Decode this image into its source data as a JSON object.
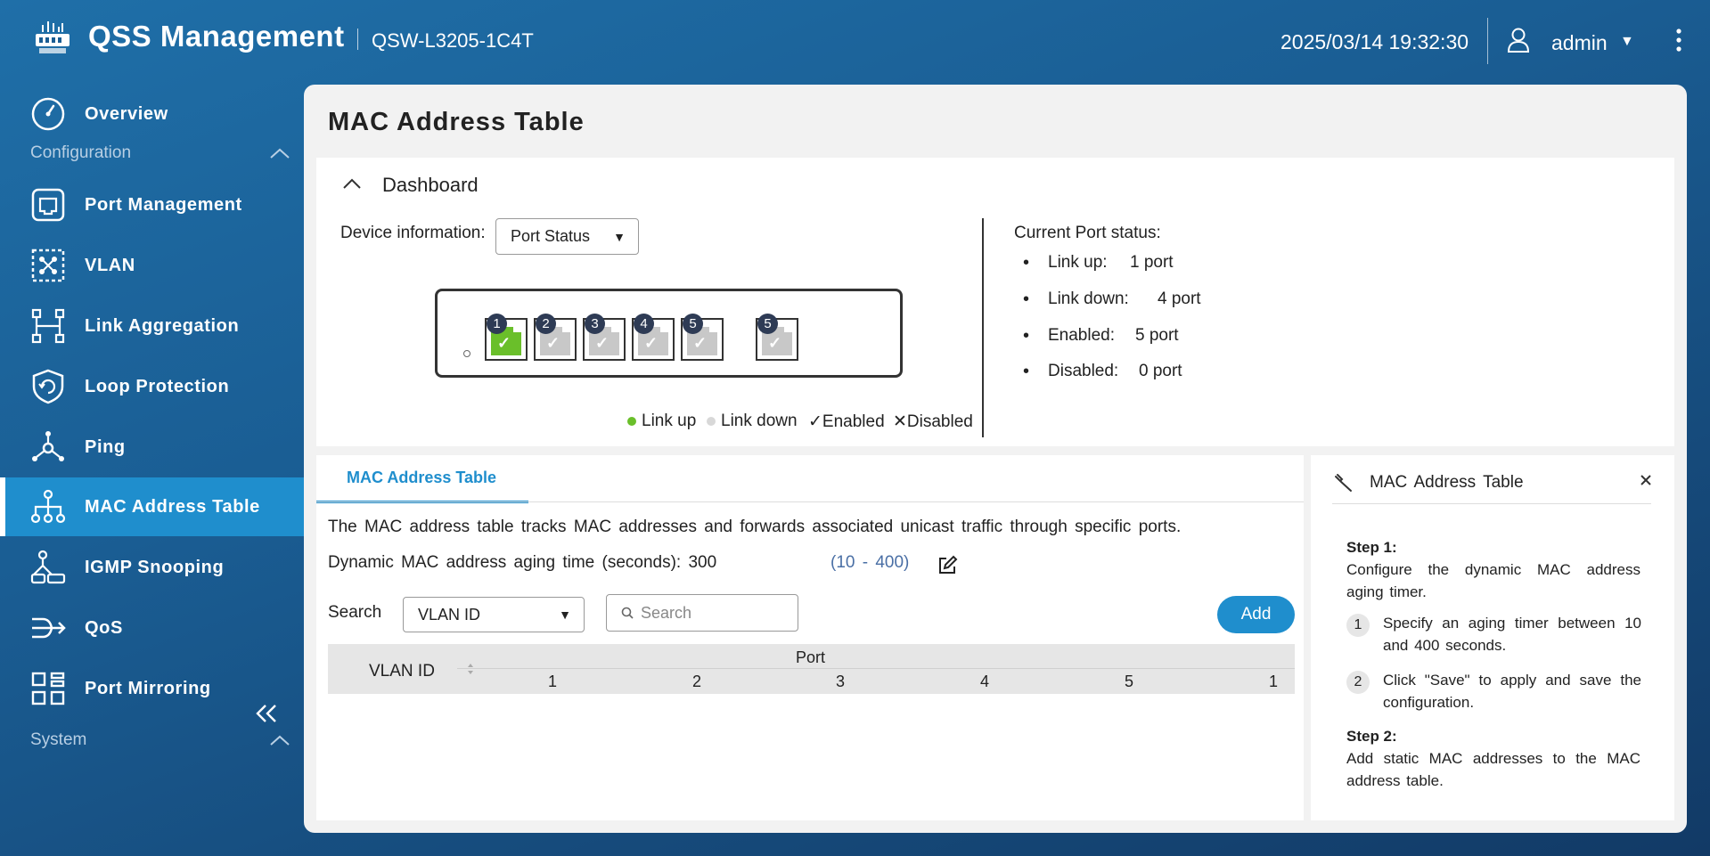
{
  "header": {
    "app_title": "QSS  Management",
    "model": "QSW-L3205-1C4T",
    "datetime": "2025/03/14  19:32:30",
    "username": "admin"
  },
  "sidebar": {
    "overview": "Overview",
    "config_section": "Configuration",
    "items": [
      {
        "label": "Port Management",
        "icon": "port-icon"
      },
      {
        "label": "VLAN",
        "icon": "vlan-icon"
      },
      {
        "label": "Link Aggregation",
        "icon": "link-aggregation-icon"
      },
      {
        "label": "Loop Protection",
        "icon": "shield-icon"
      },
      {
        "label": "Ping",
        "icon": "ping-icon"
      },
      {
        "label": "MAC Address Table",
        "icon": "network-tree-icon"
      },
      {
        "label": "IGMP Snooping",
        "icon": "igmp-icon"
      },
      {
        "label": "QoS",
        "icon": "qos-icon"
      },
      {
        "label": "Port Mirroring",
        "icon": "grid-icon"
      }
    ],
    "active_item": "MAC Address Table",
    "system_section": "System"
  },
  "page": {
    "title": "MAC  Address  Table"
  },
  "dashboard": {
    "title": "Dashboard",
    "device_info_label": "Device  information:",
    "device_info_value": "Port  Status",
    "ports": [
      {
        "num": "1",
        "status": "up"
      },
      {
        "num": "2",
        "status": "down"
      },
      {
        "num": "3",
        "status": "down"
      },
      {
        "num": "4",
        "status": "down"
      },
      {
        "num": "5",
        "status": "down"
      },
      {
        "num": "5",
        "status": "down"
      }
    ],
    "legend": {
      "link_up": "Link  up",
      "link_down": "Link  down",
      "enabled": "Enabled",
      "disabled": "Disabled"
    },
    "colors": {
      "link_up": "#6abf2a",
      "link_down": "#d0d0d0"
    },
    "status_title": "Current  Port  status:",
    "status": [
      {
        "key": "Link  up:",
        "value": "1  port"
      },
      {
        "key": "Link  down:",
        "value": "4  port"
      },
      {
        "key": "Enabled:",
        "value": "5  port"
      },
      {
        "key": "Disabled:",
        "value": "0  port"
      }
    ]
  },
  "mac_table": {
    "tab_label": "MAC Address Table",
    "description": "The  MAC  address  table  tracks  MAC  addresses  and  forwards  associated  unicast  traffic  through  specific  ports.",
    "aging_label": "Dynamic  MAC  address  aging  time  (seconds): 300",
    "aging_range": "(10  -  400)",
    "search_label": "Search",
    "search_field_value": "VLAN  ID",
    "search_placeholder": "Search",
    "add_label": "Add",
    "columns": {
      "vlan_id": "VLAN  ID",
      "port": "Port",
      "port_numbers": [
        "1",
        "2",
        "3",
        "4",
        "5",
        "1"
      ]
    }
  },
  "help": {
    "title": "MAC  Address  Table",
    "step1_title": "Step 1:",
    "step1_text": "Configure  the  dynamic  MAC  address aging  timer.",
    "step1_sub1_num": "1",
    "step1_sub1": "Specify  an  aging  timer  between 10  and  400  seconds.",
    "step1_sub2_num": "2",
    "step1_sub2": "Click  \"Save\"  to  apply  and  save the  configuration.",
    "step2_title": "Step 2:",
    "step2_text": "Add  static  MAC  addresses  to  the  MAC address  table."
  }
}
